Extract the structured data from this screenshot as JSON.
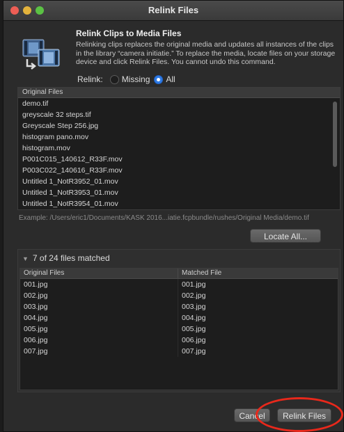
{
  "window": {
    "title": "Relink Files"
  },
  "header": {
    "heading": "Relink Clips to Media Files",
    "description": "Relinking clips replaces the original media and updates all instances of the clips in the library “camera initiatie.” To replace the media, locate files on your storage device and click Relink Files. You cannot undo this command."
  },
  "relink": {
    "label": "Relink:",
    "options": [
      {
        "label": "Missing",
        "selected": false
      },
      {
        "label": "All",
        "selected": true
      }
    ]
  },
  "original_files": {
    "header": "Original Files",
    "items": [
      "demo.tif",
      "greyscale 32 steps.tif",
      "Greyscale Step 256.jpg",
      "histogram pano.mov",
      "histogram.mov",
      "P001C015_140612_R33F.mov",
      "P003C022_140616_R33F.mov",
      "Untitled 1_NotR3952_01.mov",
      "Untitled 1_NotR3953_01.mov",
      "Untitled 1_NotR3954_01.mov"
    ]
  },
  "example_path": "Example: /Users/eric1/Documents/KASK 2016...iatie.fcpbundle/rushes/Original Media/demo.tif",
  "locate_all_label": "Locate All...",
  "matched": {
    "summary": "7 of 24 files matched",
    "columns": [
      "Original Files",
      "Matched File"
    ],
    "rows": [
      [
        "001.jpg",
        "001.jpg"
      ],
      [
        "002.jpg",
        "002.jpg"
      ],
      [
        "003.jpg",
        "003.jpg"
      ],
      [
        "004.jpg",
        "004.jpg"
      ],
      [
        "005.jpg",
        "005.jpg"
      ],
      [
        "006.jpg",
        "006.jpg"
      ],
      [
        "007.jpg",
        "007.jpg"
      ]
    ]
  },
  "buttons": {
    "cancel": "Cancel",
    "relink": "Relink Files"
  },
  "colors": {
    "accent": "#2f7be6",
    "annotation": "#e8281b"
  }
}
